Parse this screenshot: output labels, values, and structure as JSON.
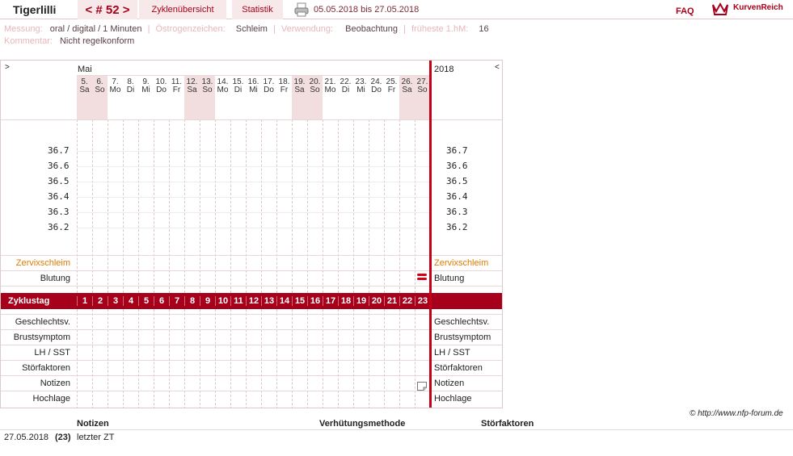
{
  "header": {
    "user": "Tigerlilli",
    "cycle": "< # 52 >",
    "tab_overview": "Zyklenübersicht",
    "tab_stats": "Statistik",
    "range": "05.05.2018 bis 27.05.2018",
    "faq": "FAQ",
    "logo": "KurvenReich"
  },
  "info": {
    "messung_label": "Messung:",
    "messung": "oral / digital / 1 Minuten",
    "oestrogen_label": "Östrogenzeichen:",
    "oestrogen": "Schleim",
    "verwendung_label": "Verwendung:",
    "verwendung": "Beobachtung",
    "hm_label": "früheste 1.hM:",
    "hm": "16",
    "kommentar_label": "Kommentar:",
    "kommentar": "Nicht regelkonform"
  },
  "chart": {
    "nav_left": ">",
    "nav_right": "<",
    "month": "Mai",
    "year": "2018",
    "days": [
      {
        "d": "5.",
        "w": "Sa",
        "we": true
      },
      {
        "d": "6.",
        "w": "So",
        "we": true
      },
      {
        "d": "7.",
        "w": "Mo",
        "we": false
      },
      {
        "d": "8.",
        "w": "Di",
        "we": false
      },
      {
        "d": "9.",
        "w": "Mi",
        "we": false
      },
      {
        "d": "10.",
        "w": "Do",
        "we": false
      },
      {
        "d": "11.",
        "w": "Fr",
        "we": false
      },
      {
        "d": "12.",
        "w": "Sa",
        "we": true
      },
      {
        "d": "13.",
        "w": "So",
        "we": true
      },
      {
        "d": "14.",
        "w": "Mo",
        "we": false
      },
      {
        "d": "15.",
        "w": "Di",
        "we": false
      },
      {
        "d": "16.",
        "w": "Mi",
        "we": false
      },
      {
        "d": "17.",
        "w": "Do",
        "we": false
      },
      {
        "d": "18.",
        "w": "Fr",
        "we": false
      },
      {
        "d": "19.",
        "w": "Sa",
        "we": true
      },
      {
        "d": "20.",
        "w": "So",
        "we": true
      },
      {
        "d": "21.",
        "w": "Mo",
        "we": false
      },
      {
        "d": "22.",
        "w": "Di",
        "we": false
      },
      {
        "d": "23.",
        "w": "Mi",
        "we": false
      },
      {
        "d": "24.",
        "w": "Do",
        "we": false
      },
      {
        "d": "25.",
        "w": "Fr",
        "we": false
      },
      {
        "d": "26.",
        "w": "Sa",
        "we": true
      },
      {
        "d": "27.",
        "w": "So",
        "we": true
      }
    ],
    "temps": [
      "36.7",
      "36.6",
      "36.5",
      "36.4",
      "36.3",
      "36.2"
    ],
    "zervix_label": "Zervixschleim",
    "blutung_label": "Blutung",
    "zyklustag_label": "Zyklustag",
    "zyklustage": [
      "1",
      "2",
      "3",
      "4",
      "5",
      "6",
      "7",
      "8",
      "9",
      "10",
      "11",
      "12",
      "13",
      "14",
      "15",
      "16",
      "17",
      "18",
      "19",
      "20",
      "21",
      "22",
      "23"
    ],
    "rows": [
      "Geschlechtsv.",
      "Brustsymptom",
      "LH / SST",
      "Störfaktoren",
      "Notizen",
      "Hochlage"
    ]
  },
  "copyright": "© http://www.nfp-forum.de",
  "notes": {
    "col_notizen": "Notizen",
    "col_verhuetung": "Verhütungsmethode",
    "col_stoer": "Störfaktoren",
    "date": "27.05.2018",
    "day": "(23)",
    "text": "letzter ZT"
  },
  "colors": {
    "accent": "#a7001b",
    "zervix": "#e07b00",
    "weekend": "#f2dede"
  }
}
